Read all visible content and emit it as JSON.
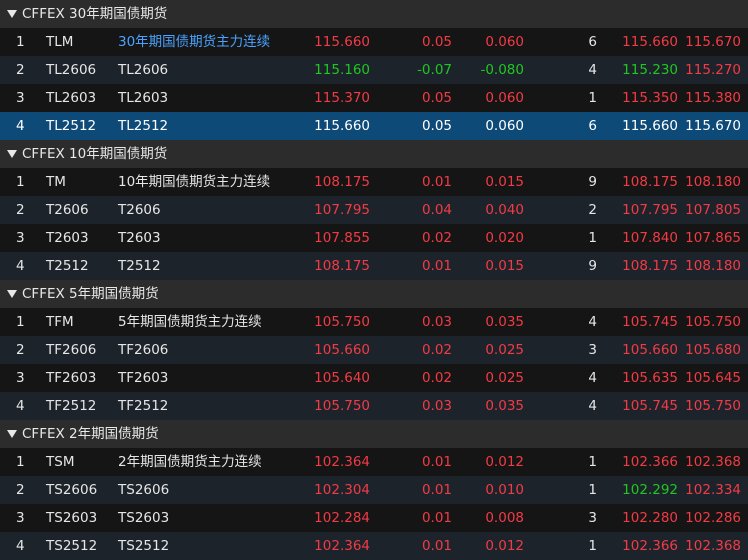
{
  "colors": {
    "up": "#f23b45",
    "down": "#21c621",
    "selected_row": "#0e4a78",
    "link": "#4aa3ff"
  },
  "groups": [
    {
      "title": "CFFEX 30年期国债期货",
      "rows": [
        {
          "idx": "1",
          "code": "TLM",
          "name": "30年期国债期货主力连续",
          "last": "115.660",
          "chg": "0.05",
          "pct": "0.060",
          "vol": "6",
          "bid": "115.660",
          "ask": "115.670",
          "dir": "up",
          "bid_dir": "up",
          "ask_dir": "up",
          "name_style": "link"
        },
        {
          "idx": "2",
          "code": "TL2606",
          "name": "TL2606",
          "last": "115.160",
          "chg": "-0.07",
          "pct": "-0.080",
          "vol": "4",
          "bid": "115.230",
          "ask": "115.270",
          "dir": "down",
          "bid_dir": "down",
          "ask_dir": "up"
        },
        {
          "idx": "3",
          "code": "TL2603",
          "name": "TL2603",
          "last": "115.370",
          "chg": "0.05",
          "pct": "0.060",
          "vol": "1",
          "bid": "115.350",
          "ask": "115.380",
          "dir": "up",
          "bid_dir": "up",
          "ask_dir": "up"
        },
        {
          "idx": "4",
          "code": "TL2512",
          "name": "TL2512",
          "last": "115.660",
          "chg": "0.05",
          "pct": "0.060",
          "vol": "6",
          "bid": "115.660",
          "ask": "115.670",
          "dir": "up",
          "bid_dir": "up",
          "ask_dir": "up",
          "selected": true
        }
      ]
    },
    {
      "title": "CFFEX 10年期国债期货",
      "rows": [
        {
          "idx": "1",
          "code": "TM",
          "name": "10年期国债期货主力连续",
          "last": "108.175",
          "chg": "0.01",
          "pct": "0.015",
          "vol": "9",
          "bid": "108.175",
          "ask": "108.180",
          "dir": "up",
          "bid_dir": "up",
          "ask_dir": "up"
        },
        {
          "idx": "2",
          "code": "T2606",
          "name": "T2606",
          "last": "107.795",
          "chg": "0.04",
          "pct": "0.040",
          "vol": "2",
          "bid": "107.795",
          "ask": "107.805",
          "dir": "up",
          "bid_dir": "up",
          "ask_dir": "up"
        },
        {
          "idx": "3",
          "code": "T2603",
          "name": "T2603",
          "last": "107.855",
          "chg": "0.02",
          "pct": "0.020",
          "vol": "1",
          "bid": "107.840",
          "ask": "107.865",
          "dir": "up",
          "bid_dir": "up",
          "ask_dir": "up"
        },
        {
          "idx": "4",
          "code": "T2512",
          "name": "T2512",
          "last": "108.175",
          "chg": "0.01",
          "pct": "0.015",
          "vol": "9",
          "bid": "108.175",
          "ask": "108.180",
          "dir": "up",
          "bid_dir": "up",
          "ask_dir": "up"
        }
      ]
    },
    {
      "title": "CFFEX 5年期国债期货",
      "rows": [
        {
          "idx": "1",
          "code": "TFM",
          "name": "5年期国债期货主力连续",
          "last": "105.750",
          "chg": "0.03",
          "pct": "0.035",
          "vol": "4",
          "bid": "105.745",
          "ask": "105.750",
          "dir": "up",
          "bid_dir": "up",
          "ask_dir": "up"
        },
        {
          "idx": "2",
          "code": "TF2606",
          "name": "TF2606",
          "last": "105.660",
          "chg": "0.02",
          "pct": "0.025",
          "vol": "3",
          "bid": "105.660",
          "ask": "105.680",
          "dir": "up",
          "bid_dir": "up",
          "ask_dir": "up"
        },
        {
          "idx": "3",
          "code": "TF2603",
          "name": "TF2603",
          "last": "105.640",
          "chg": "0.02",
          "pct": "0.025",
          "vol": "4",
          "bid": "105.635",
          "ask": "105.645",
          "dir": "up",
          "bid_dir": "up",
          "ask_dir": "up"
        },
        {
          "idx": "4",
          "code": "TF2512",
          "name": "TF2512",
          "last": "105.750",
          "chg": "0.03",
          "pct": "0.035",
          "vol": "4",
          "bid": "105.745",
          "ask": "105.750",
          "dir": "up",
          "bid_dir": "up",
          "ask_dir": "up"
        }
      ]
    },
    {
      "title": "CFFEX 2年期国债期货",
      "rows": [
        {
          "idx": "1",
          "code": "TSM",
          "name": "2年期国债期货主力连续",
          "last": "102.364",
          "chg": "0.01",
          "pct": "0.012",
          "vol": "1",
          "bid": "102.366",
          "ask": "102.368",
          "dir": "up",
          "bid_dir": "up",
          "ask_dir": "up"
        },
        {
          "idx": "2",
          "code": "TS2606",
          "name": "TS2606",
          "last": "102.304",
          "chg": "0.01",
          "pct": "0.010",
          "vol": "1",
          "bid": "102.292",
          "ask": "102.334",
          "dir": "up",
          "bid_dir": "down",
          "ask_dir": "up"
        },
        {
          "idx": "3",
          "code": "TS2603",
          "name": "TS2603",
          "last": "102.284",
          "chg": "0.01",
          "pct": "0.008",
          "vol": "3",
          "bid": "102.280",
          "ask": "102.286",
          "dir": "up",
          "bid_dir": "up",
          "ask_dir": "up"
        },
        {
          "idx": "4",
          "code": "TS2512",
          "name": "TS2512",
          "last": "102.364",
          "chg": "0.01",
          "pct": "0.012",
          "vol": "1",
          "bid": "102.366",
          "ask": "102.368",
          "dir": "up",
          "bid_dir": "up",
          "ask_dir": "up"
        }
      ]
    }
  ]
}
